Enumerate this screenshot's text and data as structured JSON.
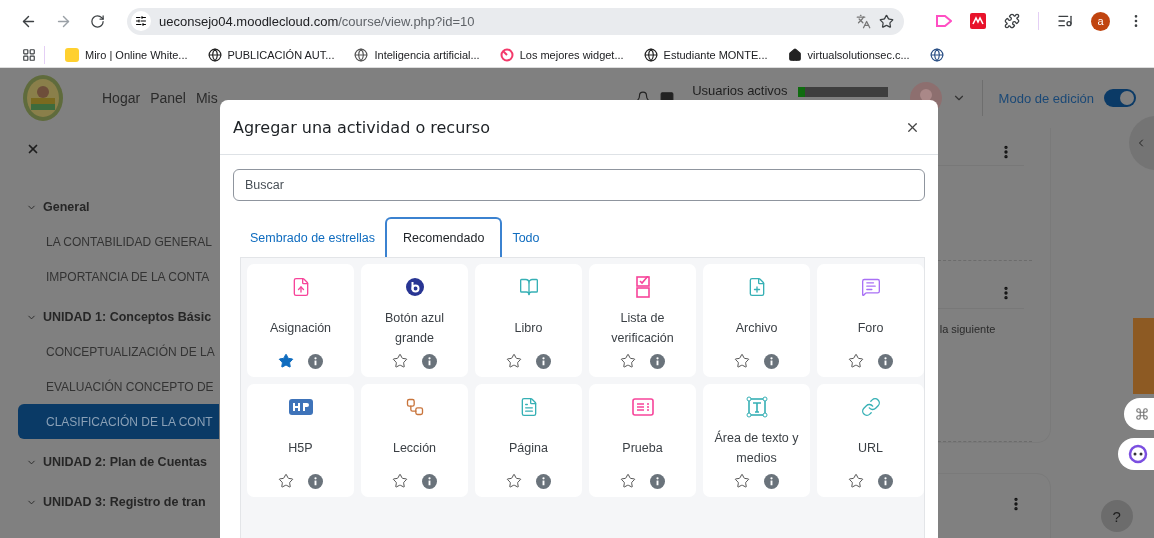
{
  "browser": {
    "url_host": "ueconsejo04.moodlecloud.com",
    "url_path": "/course/view.php?id=10",
    "avatar_letter": "a"
  },
  "bookmarks": [
    {
      "label": "Miro | Online White..."
    },
    {
      "label": "PUBLICACIÓN AUT..."
    },
    {
      "label": "Inteligencia artificial..."
    },
    {
      "label": "Los mejores widget..."
    },
    {
      "label": "Estudiante MONTE..."
    },
    {
      "label": "virtualsolutionsec.c..."
    }
  ],
  "header": {
    "nav": [
      "Hogar",
      "Panel",
      "Mis"
    ],
    "active_users": {
      "label": "Usuarios activos",
      "level": 0.08
    },
    "edit_mode": {
      "label": "Modo de edición",
      "on": true
    }
  },
  "sidebar": {
    "sections": [
      {
        "title": "General",
        "expanded": true,
        "items": [
          {
            "label": "LA CONTABILIDAD GENERAL",
            "selected": false
          },
          {
            "label": "IMPORTANCIA DE LA CONTA",
            "selected": false
          }
        ]
      },
      {
        "title": "UNIDAD 1: Conceptos Básic",
        "expanded": true,
        "items": [
          {
            "label": "CONCEPTUALIZACIÓN DE LA",
            "selected": false
          },
          {
            "label": "EVALUACIÓN CONCEPTO DE",
            "selected": false
          },
          {
            "label": "CLASIFICACIÓN DE LA CONT",
            "selected": true
          }
        ]
      },
      {
        "title": "UNIDAD 2: Plan de Cuentas",
        "expanded": true
      },
      {
        "title": "UNIDAD 3: Registro de tran",
        "expanded": true
      }
    ]
  },
  "content": {
    "text": "la siguiente"
  },
  "help": "?",
  "modal": {
    "title": "Agregar una actividad o recurso",
    "search": {
      "placeholder": "Buscar"
    },
    "tabs": [
      {
        "label": "Sembrado de estrellas",
        "selected": false
      },
      {
        "label": "Recomendado",
        "selected": true
      },
      {
        "label": "Todo",
        "selected": false
      }
    ],
    "items": [
      {
        "label": "Asignación",
        "starred": true
      },
      {
        "label": "Botón azul grande",
        "starred": false
      },
      {
        "label": "Libro",
        "starred": false
      },
      {
        "label": "Lista de verificación",
        "starred": false
      },
      {
        "label": "Archivo",
        "starred": false
      },
      {
        "label": "Foro",
        "starred": false
      },
      {
        "label": "H5P",
        "starred": false
      },
      {
        "label": "Lección",
        "starred": false
      },
      {
        "label": "Página",
        "starred": false
      },
      {
        "label": "Prueba",
        "starred": false
      },
      {
        "label": "Área de texto y medios",
        "starred": false
      },
      {
        "label": "URL",
        "starred": false
      }
    ]
  }
}
